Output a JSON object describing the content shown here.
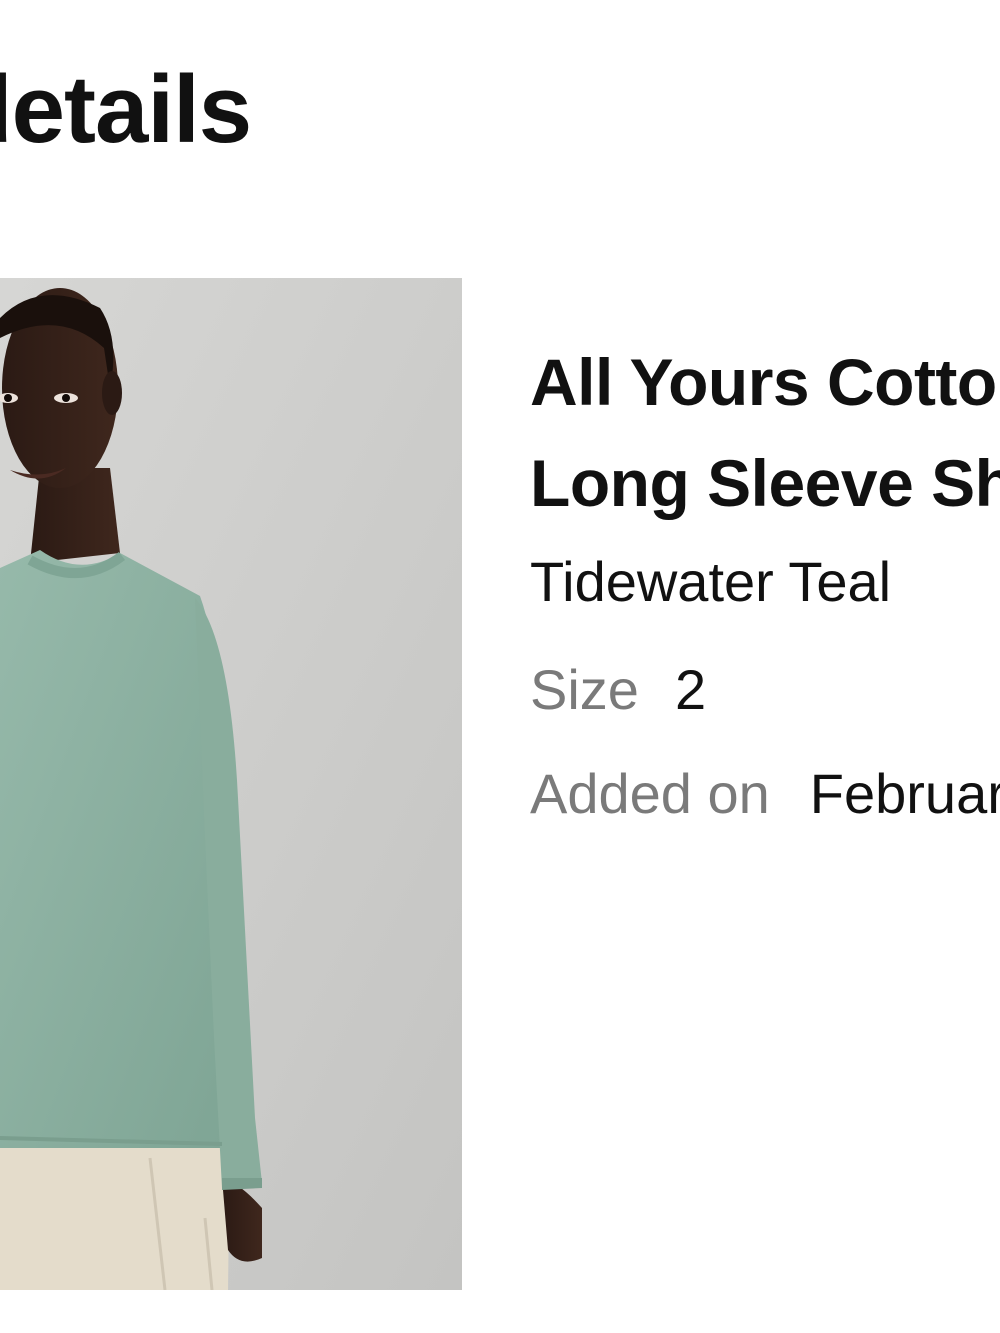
{
  "header": {
    "title": "details"
  },
  "product": {
    "image_alt": "Model wearing teal long sleeve shirt",
    "name_line1": "All Yours Cotton",
    "name_line2": "Long Sleeve Shirt",
    "color": "Tidewater Teal",
    "size_label": "Size",
    "size_value": "2",
    "added_label": "Added on",
    "added_value": "February"
  },
  "colors": {
    "shirt": "#8fb2a3",
    "background_photo": "#cdcdcb",
    "label_gray": "#7a7a7a"
  }
}
